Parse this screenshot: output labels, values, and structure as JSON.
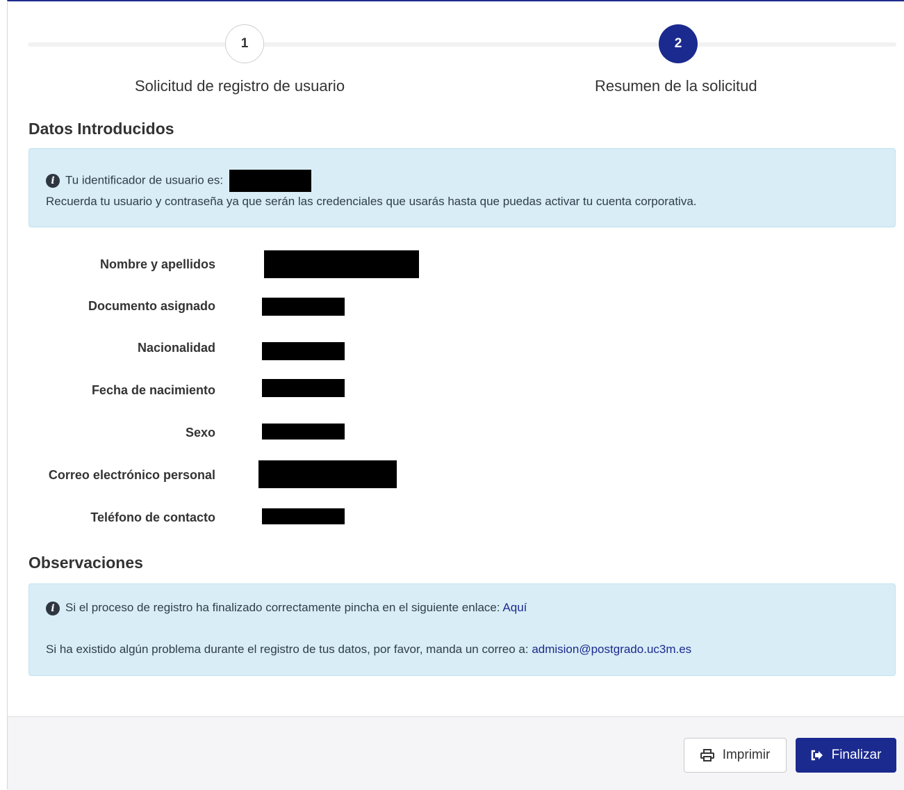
{
  "stepper": {
    "steps": [
      {
        "number": "1",
        "label": "Solicitud de registro de usuario"
      },
      {
        "number": "2",
        "label": "Resumen de la solicitud"
      }
    ],
    "active_step": 2
  },
  "datos": {
    "title": "Datos Introducidos",
    "alert_user_prefix": "Tu identificador de usuario es:",
    "alert_user_note": "Recuerda tu usuario y contraseña ya que serán las credenciales que usarás hasta que puedas activar tu cuenta corporativa.",
    "fields": [
      {
        "label": "Nombre y apellidos"
      },
      {
        "label": "Documento asignado"
      },
      {
        "label": "Nacionalidad"
      },
      {
        "label": "Fecha de nacimiento"
      },
      {
        "label": "Sexo"
      },
      {
        "label": "Correo electrónico personal"
      },
      {
        "label": "Teléfono de contacto"
      }
    ]
  },
  "observaciones": {
    "title": "Observaciones",
    "line1_text": "Si el proceso de registro ha finalizado correctamente pincha en el siguiente enlace:",
    "line1_link": "Aquí",
    "line2_text": "Si ha existido algún problema durante el registro de tus datos, por favor, manda un correo a:",
    "line2_link": "admision@postgrado.uc3m.es"
  },
  "footer": {
    "print_label": "Imprimir",
    "finish_label": "Finalizar"
  },
  "colors": {
    "primary": "#1b2a8f",
    "alert_bg": "#d9edf6",
    "footer_bg": "#f5f5f7"
  }
}
